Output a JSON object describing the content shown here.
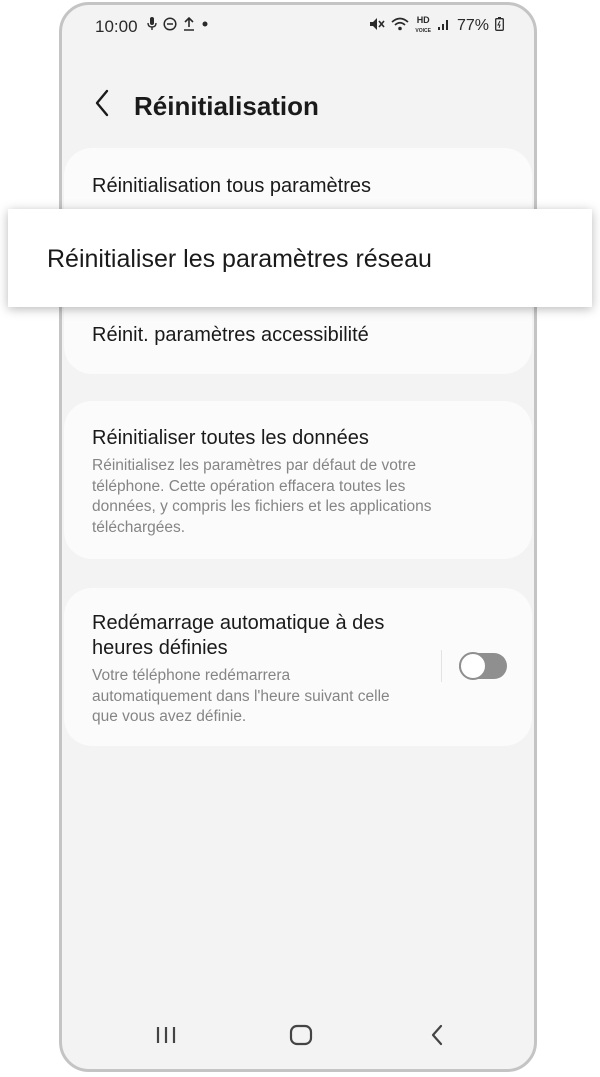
{
  "status_bar": {
    "time": "10:00",
    "battery": "77%",
    "network_badge_top": "HD",
    "network_badge_bottom": "VOICE"
  },
  "header": {
    "title": "Réinitialisation"
  },
  "reset_group": {
    "items": [
      {
        "label": "Réinitialisation tous paramètres"
      },
      {
        "label": "Réinitialiser les paramètres réseau"
      },
      {
        "label": "Réinit. paramètres accessibilité"
      }
    ]
  },
  "factory_reset": {
    "title": "Réinitialiser toutes les données",
    "description": "Réinitialisez les paramètres par défaut de votre téléphone. Cette opération effacera toutes les données, y compris les fichiers et les applications téléchargées."
  },
  "auto_restart": {
    "title": "Redémarrage automatique à des heures définies",
    "description": "Votre téléphone redémarrera automatiquement dans l'heure suivant celle que vous avez définie.",
    "enabled": false
  },
  "colors": {
    "background": "#f3f3f3",
    "card": "#fbfbfb",
    "toggle_off": "#8f8f8f",
    "secondary_text": "#858585"
  }
}
